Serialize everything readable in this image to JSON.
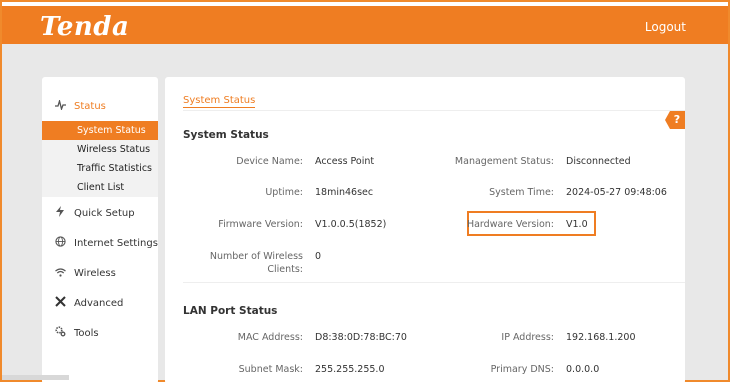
{
  "header": {
    "logo": "Tenda",
    "logout": "Logout"
  },
  "sidebar": {
    "status": "Status",
    "sub_items": [
      "System Status",
      "Wireless Status",
      "Traffic Statistics",
      "Client List"
    ],
    "quick_setup": "Quick Setup",
    "internet_settings": "Internet Settings",
    "wireless": "Wireless",
    "advanced": "Advanced",
    "tools": "Tools"
  },
  "main": {
    "tab": "System Status",
    "help": "?",
    "system_status": {
      "title": "System Status",
      "device_name_label": "Device Name:",
      "device_name": "Access Point",
      "management_status_label": "Management Status:",
      "management_status": "Disconnected",
      "uptime_label": "Uptime:",
      "uptime": "18min46sec",
      "system_time_label": "System Time:",
      "system_time": "2024-05-27 09:48:06",
      "firmware_label": "Firmware Version:",
      "firmware": "V1.0.0.5(1852)",
      "hardware_label": "Hardware Version:",
      "hardware": "V1.0",
      "clients_label_1": "Number of Wireless",
      "clients_label_2": "Clients:",
      "clients": "0"
    },
    "lan_status": {
      "title": "LAN Port Status",
      "mac_label": "MAC Address:",
      "mac": "D8:38:0D:78:BC:70",
      "ip_label": "IP Address:",
      "ip": "192.168.1.200",
      "subnet_label": "Subnet Mask:",
      "subnet": "255.255.255.0",
      "dns_label": "Primary DNS:",
      "dns": "0.0.0.0"
    }
  }
}
